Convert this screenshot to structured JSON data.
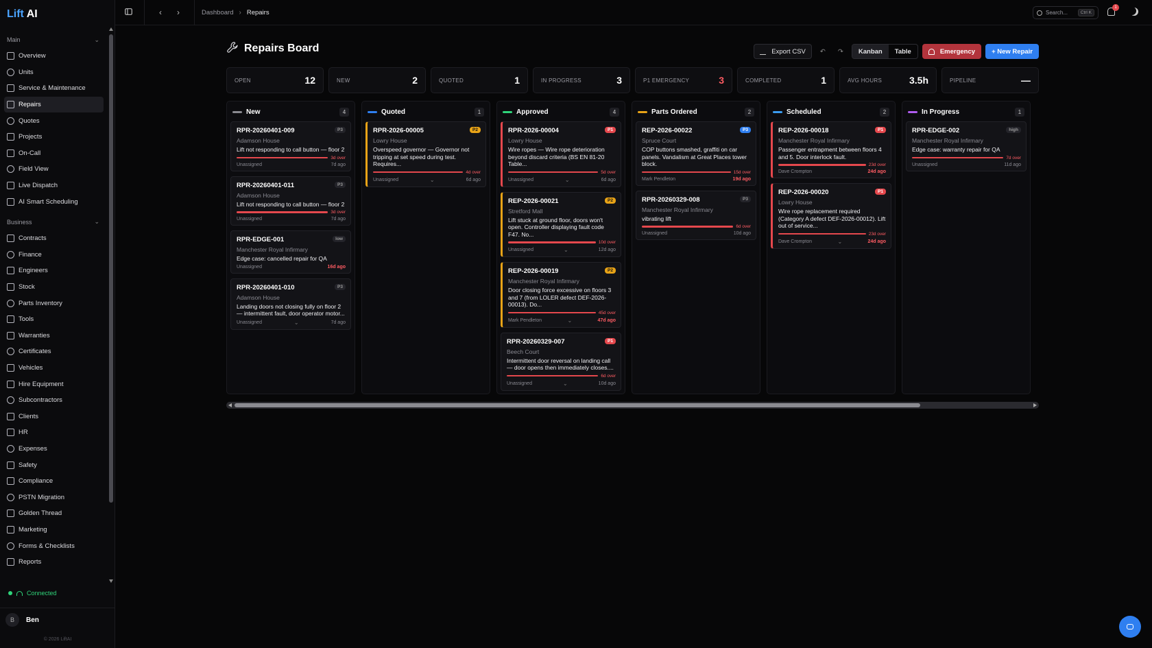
{
  "app": {
    "logo_prefix": "Lift",
    "logo_suffix": " AI",
    "copyright": "© 2026 LiftAI"
  },
  "sidebar": {
    "sections": [
      {
        "title": "Main",
        "items": [
          {
            "label": "Overview",
            "icon": "grid-icon"
          },
          {
            "label": "Units",
            "icon": "building-icon"
          },
          {
            "label": "Service & Maintenance",
            "icon": "clipboard-icon"
          },
          {
            "label": "Repairs",
            "icon": "wrench-icon",
            "active": true
          },
          {
            "label": "Quotes",
            "icon": "file-icon"
          },
          {
            "label": "Projects",
            "icon": "folder-icon"
          },
          {
            "label": "On-Call",
            "icon": "phone-icon"
          },
          {
            "label": "Field View",
            "icon": "map-pin-icon"
          },
          {
            "label": "Live Dispatch",
            "icon": "radio-icon"
          },
          {
            "label": "AI Smart Scheduling",
            "icon": "sparkle-icon"
          }
        ]
      },
      {
        "title": "Business",
        "items": [
          {
            "label": "Contracts",
            "icon": "file-icon"
          },
          {
            "label": "Finance",
            "icon": "pound-icon"
          },
          {
            "label": "Engineers",
            "icon": "users-icon"
          },
          {
            "label": "Stock",
            "icon": "box-icon"
          },
          {
            "label": "Parts Inventory",
            "icon": "package-icon"
          },
          {
            "label": "Tools",
            "icon": "tool-icon"
          },
          {
            "label": "Warranties",
            "icon": "shield-icon"
          },
          {
            "label": "Certificates",
            "icon": "award-icon"
          },
          {
            "label": "Vehicles",
            "icon": "truck-icon"
          },
          {
            "label": "Hire Equipment",
            "icon": "crate-icon"
          },
          {
            "label": "Subcontractors",
            "icon": "handshake-icon"
          },
          {
            "label": "Clients",
            "icon": "user-icon"
          },
          {
            "label": "HR",
            "icon": "user-check-icon"
          },
          {
            "label": "Expenses",
            "icon": "receipt-icon"
          },
          {
            "label": "Safety",
            "icon": "shield-icon"
          },
          {
            "label": "Compliance",
            "icon": "check-shield-icon"
          },
          {
            "label": "PSTN Migration",
            "icon": "phone-icon"
          },
          {
            "label": "Golden Thread",
            "icon": "thread-icon"
          },
          {
            "label": "Marketing",
            "icon": "megaphone-icon"
          },
          {
            "label": "Forms & Checklists",
            "icon": "checklist-icon"
          },
          {
            "label": "Reports",
            "icon": "bar-chart-icon"
          }
        ]
      }
    ],
    "status": "Connected",
    "user": {
      "initial": "B",
      "name": "Ben"
    }
  },
  "topbar": {
    "breadcrumb": [
      "Dashboard",
      "Repairs"
    ],
    "search_placeholder": "Search...",
    "search_shortcut": "Ctrl K",
    "notifications_count": "1"
  },
  "page": {
    "title": "Repairs Board",
    "export_label": "Export CSV",
    "views": [
      "Kanban",
      "Table"
    ],
    "active_view": "Kanban",
    "emergency_label": "Emergency",
    "new_label": "+ New Repair"
  },
  "stats": [
    {
      "label": "OPEN",
      "value": "12"
    },
    {
      "label": "NEW",
      "value": "2"
    },
    {
      "label": "QUOTED",
      "value": "1"
    },
    {
      "label": "IN PROGRESS",
      "value": "3"
    },
    {
      "label": "P1 EMERGENCY",
      "value": "3",
      "alert": true
    },
    {
      "label": "COMPLETED",
      "value": "1"
    },
    {
      "label": "AVG HOURS",
      "value": "3.5h"
    },
    {
      "label": "PIPELINE",
      "value": "—"
    }
  ],
  "columns": [
    {
      "title": "New",
      "count": "4",
      "color": "#8a8a90",
      "cards": [
        {
          "id": "RPR-20260401-009",
          "priority": "P3",
          "site": "Adamson House",
          "desc": "Lift not responding to call button — floor 2",
          "over": "3d over",
          "assignee": "Unassigned",
          "age": "7d ago"
        },
        {
          "id": "RPR-20260401-011",
          "priority": "P3",
          "site": "Adamson House",
          "desc": "Lift not responding to call button — floor 2",
          "over": "3d over",
          "assignee": "Unassigned",
          "age": "7d ago"
        },
        {
          "id": "RPR-EDGE-001",
          "priority": "low",
          "site": "Manchester Royal Infirmary",
          "desc": "Edge case: cancelled repair for QA",
          "assignee": "Unassigned",
          "age": "16d ago",
          "age_red": true
        },
        {
          "id": "RPR-20260401-010",
          "priority": "P3",
          "site": "Adamson House",
          "desc": "Landing doors not closing fully on floor 2 — intermittent fault, door operator motor...",
          "assignee": "Unassigned",
          "age": "7d ago",
          "chevron": true
        }
      ]
    },
    {
      "title": "Quoted",
      "count": "1",
      "color": "#2f7ff0",
      "cards": [
        {
          "id": "RPR-2026-00005",
          "priority": "P2",
          "site": "Lowry House",
          "desc": "Overspeed governor — Governor not tripping at set speed during test. Requires...",
          "over": "4d over",
          "assignee": "Unassigned",
          "age": "6d ago",
          "chevron": true,
          "accent": "amber"
        }
      ]
    },
    {
      "title": "Approved",
      "count": "4",
      "color": "#2fd47a",
      "cards": [
        {
          "id": "RPR-2026-00004",
          "priority": "P1",
          "site": "Lowry House",
          "desc": "Wire ropes — Wire rope deterioration beyond discard criteria (BS EN 81-20 Table...",
          "over": "5d over",
          "assignee": "Unassigned",
          "age": "6d ago",
          "chevron": true,
          "accent": "red"
        },
        {
          "id": "REP-2026-00021",
          "priority": "P2",
          "site": "Stretford Mall",
          "desc": "Lift stuck at ground floor, doors won't open. Controller displaying fault code F47. No...",
          "over": "10d over",
          "assignee": "Unassigned",
          "age": "12d ago",
          "chevron": true,
          "accent": "amber"
        },
        {
          "id": "REP-2026-00019",
          "priority": "P2",
          "site": "Manchester Royal Infirmary",
          "desc": "Door closing force excessive on floors 3 and 7 (from LOLER defect DEF-2026-00013). Do...",
          "over": "45d over",
          "assignee": "Mark Pendleton",
          "age": "47d ago",
          "age_red": true,
          "chevron": true,
          "accent": "amber"
        },
        {
          "id": "RPR-20260329-007",
          "priority": "P1",
          "site": "Beech Court",
          "desc": "Intermittent door reversal on landing call — door opens then immediately closes....",
          "over": "6d over",
          "assignee": "Unassigned",
          "age": "10d ago",
          "chevron": true
        }
      ]
    },
    {
      "title": "Parts Ordered",
      "count": "2",
      "color": "#e8a317",
      "cards": [
        {
          "id": "REP-2026-00022",
          "priority": "P3",
          "priority_blue": true,
          "site": "Spruce Court",
          "desc": "COP buttons smashed, graffiti on car panels. Vandalism at Great Places tower block.",
          "over": "15d over",
          "assignee": "Mark Pendleton",
          "age": "19d ago",
          "age_red": true
        },
        {
          "id": "RPR-20260329-008",
          "priority": "P3",
          "site": "Manchester Royal Infirmary",
          "desc": "vibrating lift",
          "over": "6d over",
          "assignee": "Unassigned",
          "age": "10d ago"
        }
      ]
    },
    {
      "title": "Scheduled",
      "count": "2",
      "color": "#3b9cf0",
      "cards": [
        {
          "id": "REP-2026-00018",
          "priority": "P1",
          "site": "Manchester Royal Infirmary",
          "desc": "Passenger entrapment between floors 4 and 5. Door interlock fault.",
          "over": "23d over",
          "assignee": "Dave Crompton",
          "age": "24d ago",
          "age_red": true,
          "accent": "red"
        },
        {
          "id": "REP-2026-00020",
          "priority": "P1",
          "site": "Lowry House",
          "desc": "Wire rope replacement required (Category A defect DEF-2026-00012). Lift out of service...",
          "over": "23d over",
          "assignee": "Dave Crompton",
          "age": "24d ago",
          "age_red": true,
          "chevron": true,
          "accent": "red"
        }
      ]
    },
    {
      "title": "In Progress",
      "count": "1",
      "color": "#b05cf0",
      "cards": [
        {
          "id": "RPR-EDGE-002",
          "priority": "high",
          "site": "Manchester Royal Infirmary",
          "desc": "Edge case: warranty repair for QA",
          "over": "7d over",
          "assignee": "Unassigned",
          "age": "11d ago"
        }
      ]
    }
  ],
  "colors": {
    "accent": "#2f7ff0",
    "danger": "#e5484d",
    "warning": "#e8a317",
    "success": "#2fd47a"
  }
}
